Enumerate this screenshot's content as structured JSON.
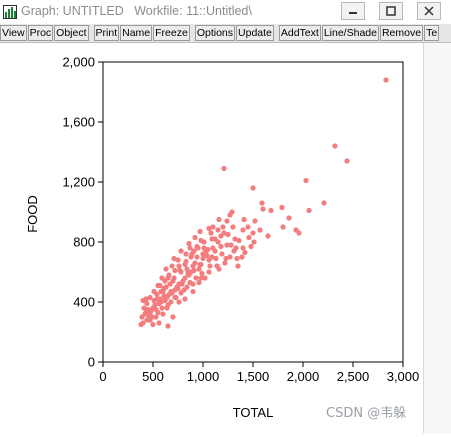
{
  "window": {
    "title": "Graph: UNTITLED   Workfile: 11::Untitled\\",
    "buttons": [
      "minimize-icon",
      "maximize-icon",
      "close-icon"
    ]
  },
  "toolbar": {
    "groups": [
      [
        "View",
        "Proc",
        "Object"
      ],
      [
        "Print",
        "Name",
        "Freeze"
      ],
      [
        "Options",
        "Update"
      ],
      [
        "AddText",
        "Line/Shade",
        "Remove",
        "Te"
      ]
    ]
  },
  "watermark": "CSDN @韦躲",
  "colors": {
    "marker": "#f47c7c",
    "axis": "#000000"
  },
  "chart_data": {
    "type": "scatter",
    "xlabel": "TOTAL",
    "ylabel": "FOOD",
    "xlim": [
      0,
      3000
    ],
    "ylim": [
      0,
      2000
    ],
    "xticks": [
      "0",
      "500",
      "1,000",
      "1,500",
      "2,000",
      "2,500",
      "3,000"
    ],
    "yticks": [
      "0",
      "400",
      "800",
      "1,200",
      "1,600",
      "2,000"
    ],
    "grid": false,
    "points": [
      [
        2830,
        1880
      ],
      [
        2320,
        1440
      ],
      [
        2440,
        1340
      ],
      [
        2030,
        1210
      ],
      [
        1210,
        1290
      ],
      [
        1500,
        1160
      ],
      [
        1590,
        1060
      ],
      [
        1790,
        1030
      ],
      [
        2060,
        1010
      ],
      [
        2210,
        1060
      ],
      [
        1680,
        1010
      ],
      [
        1860,
        960
      ],
      [
        1930,
        880
      ],
      [
        1960,
        860
      ],
      [
        1500,
        860
      ],
      [
        1460,
        830
      ],
      [
        1510,
        800
      ],
      [
        1650,
        840
      ],
      [
        1800,
        900
      ],
      [
        1400,
        760
      ],
      [
        1350,
        640
      ],
      [
        1340,
        690
      ],
      [
        1450,
        900
      ],
      [
        1210,
        860
      ],
      [
        1300,
        900
      ],
      [
        1250,
        850
      ],
      [
        1400,
        880
      ],
      [
        1320,
        820
      ],
      [
        1280,
        780
      ],
      [
        1180,
        770
      ],
      [
        1150,
        800
      ],
      [
        1120,
        740
      ],
      [
        1090,
        700
      ],
      [
        1060,
        680
      ],
      [
        1030,
        740
      ],
      [
        1000,
        690
      ],
      [
        980,
        650
      ],
      [
        960,
        620
      ],
      [
        940,
        700
      ],
      [
        920,
        660
      ],
      [
        900,
        640
      ],
      [
        880,
        600
      ],
      [
        860,
        580
      ],
      [
        840,
        620
      ],
      [
        820,
        560
      ],
      [
        800,
        540
      ],
      [
        780,
        600
      ],
      [
        760,
        520
      ],
      [
        740,
        500
      ],
      [
        720,
        480
      ],
      [
        700,
        540
      ],
      [
        680,
        470
      ],
      [
        660,
        450
      ],
      [
        640,
        430
      ],
      [
        620,
        410
      ],
      [
        600,
        470
      ],
      [
        580,
        400
      ],
      [
        560,
        390
      ],
      [
        540,
        420
      ],
      [
        520,
        380
      ],
      [
        500,
        360
      ],
      [
        480,
        340
      ],
      [
        460,
        300
      ],
      [
        440,
        280
      ],
      [
        420,
        320
      ],
      [
        400,
        260
      ],
      [
        380,
        250
      ],
      [
        390,
        300
      ],
      [
        410,
        360
      ],
      [
        430,
        330
      ],
      [
        450,
        350
      ],
      [
        470,
        320
      ],
      [
        490,
        300
      ],
      [
        510,
        410
      ],
      [
        530,
        350
      ],
      [
        550,
        330
      ],
      [
        570,
        420
      ],
      [
        590,
        360
      ],
      [
        610,
        440
      ],
      [
        630,
        500
      ],
      [
        650,
        380
      ],
      [
        670,
        520
      ],
      [
        690,
        460
      ],
      [
        710,
        560
      ],
      [
        730,
        430
      ],
      [
        750,
        490
      ],
      [
        770,
        610
      ],
      [
        790,
        520
      ],
      [
        810,
        480
      ],
      [
        830,
        670
      ],
      [
        850,
        590
      ],
      [
        870,
        530
      ],
      [
        890,
        720
      ],
      [
        910,
        610
      ],
      [
        930,
        560
      ],
      [
        950,
        760
      ],
      [
        970,
        650
      ],
      [
        990,
        590
      ],
      [
        1010,
        800
      ],
      [
        1040,
        710
      ],
      [
        1070,
        640
      ],
      [
        1100,
        760
      ],
      [
        1130,
        690
      ],
      [
        1160,
        620
      ],
      [
        1190,
        720
      ],
      [
        1220,
        660
      ],
      [
        1240,
        780
      ],
      [
        1270,
        700
      ],
      [
        1310,
        740
      ],
      [
        1360,
        810
      ],
      [
        1420,
        730
      ],
      [
        1480,
        770
      ],
      [
        700,
        300
      ],
      [
        650,
        240
      ],
      [
        600,
        320
      ],
      [
        560,
        260
      ],
      [
        530,
        300
      ],
      [
        500,
        250
      ],
      [
        470,
        280
      ],
      [
        1020,
        560
      ],
      [
        960,
        530
      ],
      [
        900,
        520
      ],
      [
        840,
        500
      ],
      [
        780,
        460
      ],
      [
        720,
        430
      ],
      [
        680,
        400
      ],
      [
        640,
        360
      ],
      [
        780,
        740
      ],
      [
        860,
        790
      ],
      [
        940,
        770
      ],
      [
        1050,
        750
      ],
      [
        1120,
        820
      ],
      [
        980,
        810
      ],
      [
        1200,
        900
      ],
      [
        1080,
        860
      ],
      [
        1000,
        720
      ],
      [
        880,
        700
      ],
      [
        820,
        650
      ],
      [
        760,
        640
      ],
      [
        720,
        610
      ],
      [
        660,
        580
      ],
      [
        620,
        540
      ],
      [
        580,
        470
      ],
      [
        540,
        450
      ],
      [
        440,
        390
      ],
      [
        400,
        410
      ],
      [
        760,
        400
      ],
      [
        820,
        420
      ],
      [
        900,
        470
      ],
      [
        980,
        560
      ],
      [
        1060,
        600
      ],
      [
        1140,
        640
      ],
      [
        1230,
        690
      ],
      [
        1330,
        760
      ],
      [
        1390,
        700
      ],
      [
        1570,
        880
      ],
      [
        1600,
        1020
      ],
      [
        1270,
        980
      ],
      [
        1160,
        950
      ],
      [
        1060,
        890
      ],
      [
        970,
        870
      ],
      [
        920,
        830
      ],
      [
        1100,
        900
      ],
      [
        1410,
        950
      ],
      [
        1520,
        940
      ],
      [
        1290,
        1000
      ],
      [
        690,
        640
      ],
      [
        630,
        620
      ],
      [
        590,
        560
      ],
      [
        550,
        510
      ],
      [
        470,
        430
      ],
      [
        430,
        420
      ],
      [
        510,
        470
      ],
      [
        610,
        490
      ],
      [
        570,
        510
      ],
      [
        650,
        560
      ],
      [
        710,
        690
      ],
      [
        750,
        680
      ],
      [
        1150,
        880
      ],
      [
        1240,
        940
      ],
      [
        870,
        760
      ],
      [
        1010,
        760
      ],
      [
        1090,
        820
      ],
      [
        1180,
        840
      ],
      [
        830,
        720
      ],
      [
        910,
        740
      ]
    ]
  }
}
